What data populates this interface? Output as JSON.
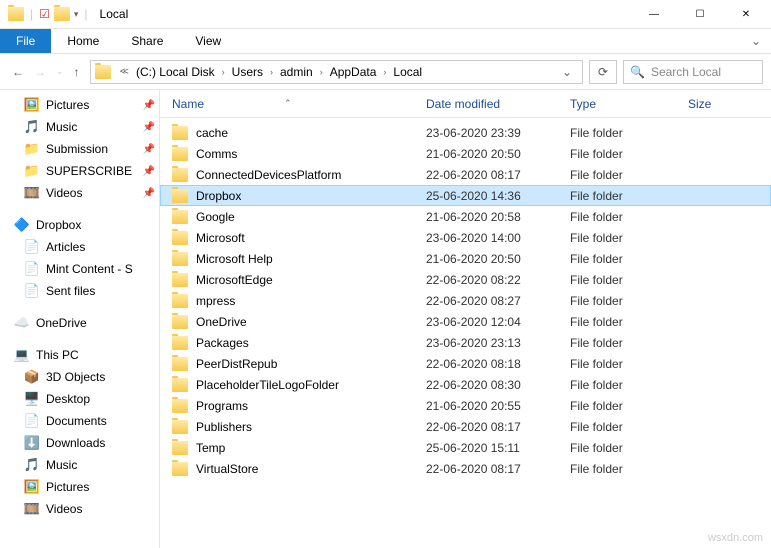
{
  "window": {
    "title": "Local"
  },
  "ribbon": {
    "file": "File",
    "home": "Home",
    "share": "Share",
    "view": "View"
  },
  "address": {
    "segments": [
      "(C:) Local Disk",
      "Users",
      "admin",
      "AppData",
      "Local"
    ]
  },
  "search": {
    "placeholder": "Search Local"
  },
  "columns": {
    "name": "Name",
    "date": "Date modified",
    "type": "Type",
    "size": "Size"
  },
  "sidebar": {
    "quick": [
      {
        "label": "Pictures",
        "pinned": true,
        "icon": "🖼️"
      },
      {
        "label": "Music",
        "pinned": true,
        "icon": "🎵"
      },
      {
        "label": "Submission",
        "pinned": true,
        "icon": "📁"
      },
      {
        "label": "SUPERSCRIBE",
        "pinned": true,
        "icon": "📁"
      },
      {
        "label": "Videos",
        "pinned": true,
        "icon": "🎞️"
      }
    ],
    "dropbox": {
      "label": "Dropbox",
      "items": [
        {
          "label": "Articles",
          "icon": "📄"
        },
        {
          "label": "Mint Content - S",
          "icon": "📄"
        },
        {
          "label": "Sent files",
          "icon": "📄"
        }
      ]
    },
    "onedrive": {
      "label": "OneDrive"
    },
    "thispc": {
      "label": "This PC",
      "items": [
        {
          "label": "3D Objects",
          "icon": "📦"
        },
        {
          "label": "Desktop",
          "icon": "🖥️"
        },
        {
          "label": "Documents",
          "icon": "📄"
        },
        {
          "label": "Downloads",
          "icon": "⬇️"
        },
        {
          "label": "Music",
          "icon": "🎵"
        },
        {
          "label": "Pictures",
          "icon": "🖼️"
        },
        {
          "label": "Videos",
          "icon": "🎞️"
        }
      ]
    }
  },
  "files": [
    {
      "name": "cache",
      "date": "23-06-2020 23:39",
      "type": "File folder",
      "selected": false
    },
    {
      "name": "Comms",
      "date": "21-06-2020 20:50",
      "type": "File folder",
      "selected": false
    },
    {
      "name": "ConnectedDevicesPlatform",
      "date": "22-06-2020 08:17",
      "type": "File folder",
      "selected": false
    },
    {
      "name": "Dropbox",
      "date": "25-06-2020 14:36",
      "type": "File folder",
      "selected": true
    },
    {
      "name": "Google",
      "date": "21-06-2020 20:58",
      "type": "File folder",
      "selected": false
    },
    {
      "name": "Microsoft",
      "date": "23-06-2020 14:00",
      "type": "File folder",
      "selected": false
    },
    {
      "name": "Microsoft Help",
      "date": "21-06-2020 20:50",
      "type": "File folder",
      "selected": false
    },
    {
      "name": "MicrosoftEdge",
      "date": "22-06-2020 08:22",
      "type": "File folder",
      "selected": false
    },
    {
      "name": "mpress",
      "date": "22-06-2020 08:27",
      "type": "File folder",
      "selected": false
    },
    {
      "name": "OneDrive",
      "date": "23-06-2020 12:04",
      "type": "File folder",
      "selected": false
    },
    {
      "name": "Packages",
      "date": "23-06-2020 23:13",
      "type": "File folder",
      "selected": false
    },
    {
      "name": "PeerDistRepub",
      "date": "22-06-2020 08:18",
      "type": "File folder",
      "selected": false
    },
    {
      "name": "PlaceholderTileLogoFolder",
      "date": "22-06-2020 08:30",
      "type": "File folder",
      "selected": false
    },
    {
      "name": "Programs",
      "date": "21-06-2020 20:55",
      "type": "File folder",
      "selected": false
    },
    {
      "name": "Publishers",
      "date": "22-06-2020 08:17",
      "type": "File folder",
      "selected": false
    },
    {
      "name": "Temp",
      "date": "25-06-2020 15:11",
      "type": "File folder",
      "selected": false
    },
    {
      "name": "VirtualStore",
      "date": "22-06-2020 08:17",
      "type": "File folder",
      "selected": false
    }
  ],
  "watermark": "wsxdn.com"
}
